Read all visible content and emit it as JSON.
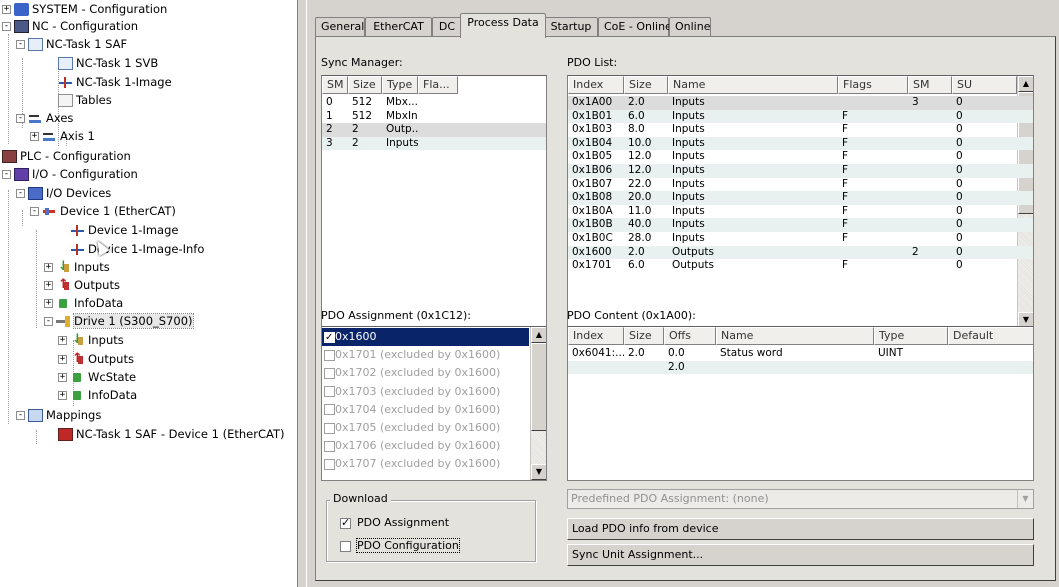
{
  "tree": {
    "nodes": [
      {
        "label": "SYSTEM - Configuration",
        "icon": "system-config-icon",
        "expander": "+"
      },
      {
        "label": "NC - Configuration",
        "icon": "nc-config-icon",
        "expander": "-"
      },
      {
        "label": "NC-Task 1 SAF",
        "icon": "task-icon",
        "expander": "-"
      },
      {
        "label": "NC-Task 1 SVB",
        "icon": "task-icon",
        "expander": ""
      },
      {
        "label": "NC-Task 1-Image",
        "icon": "image-icon",
        "expander": ""
      },
      {
        "label": "Tables",
        "icon": "tables-icon",
        "expander": ""
      },
      {
        "label": "Axes",
        "icon": "axes-icon",
        "expander": "-"
      },
      {
        "label": "Axis 1",
        "icon": "axis-icon",
        "expander": "+"
      },
      {
        "label": "PLC - Configuration",
        "icon": "plc-config-icon",
        "expander": ""
      },
      {
        "label": "I/O - Configuration",
        "icon": "io-config-icon",
        "expander": "-"
      },
      {
        "label": "I/O Devices",
        "icon": "io-devices-icon",
        "expander": "-"
      },
      {
        "label": "Device 1 (EtherCAT)",
        "icon": "ethercat-device-icon",
        "expander": "-"
      },
      {
        "label": "Device 1-Image",
        "icon": "image-icon",
        "expander": ""
      },
      {
        "label": "Device 1-Image-Info",
        "icon": "image-icon",
        "expander": ""
      },
      {
        "label": "Inputs",
        "icon": "inputs-icon",
        "expander": "+"
      },
      {
        "label": "Outputs",
        "icon": "outputs-icon",
        "expander": "+"
      },
      {
        "label": "InfoData",
        "icon": "infodata-icon",
        "expander": "+"
      },
      {
        "label": "Drive 1 (S300_S700)",
        "icon": "drive-icon",
        "expander": "-"
      },
      {
        "label": "Inputs",
        "icon": "inputs-icon",
        "expander": "+"
      },
      {
        "label": "Outputs",
        "icon": "outputs-icon",
        "expander": "+"
      },
      {
        "label": "WcState",
        "icon": "wcstate-icon",
        "expander": "+"
      },
      {
        "label": "InfoData",
        "icon": "infodata-icon",
        "expander": "+"
      },
      {
        "label": "Mappings",
        "icon": "mappings-icon",
        "expander": "-"
      },
      {
        "label": "NC-Task 1 SAF - Device 1 (EtherCAT)",
        "icon": "mapping-link-icon",
        "expander": ""
      }
    ]
  },
  "tabs": [
    "General",
    "EtherCAT",
    "DC",
    "Process Data",
    "Startup",
    "CoE - Online",
    "Online"
  ],
  "active_tab": "Process Data",
  "sync_manager": {
    "caption": "Sync Manager:",
    "headers": [
      "SM",
      "Size",
      "Type",
      "Fla..."
    ],
    "rows": [
      [
        "0",
        "512",
        "Mbx...",
        ""
      ],
      [
        "1",
        "512",
        "MbxIn",
        ""
      ],
      [
        "2",
        "2",
        "Outp...",
        ""
      ],
      [
        "3",
        "2",
        "Inputs",
        ""
      ]
    ]
  },
  "pdo_list": {
    "caption": "PDO List:",
    "headers": [
      "Index",
      "Size",
      "Name",
      "Flags",
      "SM",
      "SU"
    ],
    "rows": [
      [
        "0x1A00",
        "2.0",
        "Inputs",
        "",
        "3",
        "0"
      ],
      [
        "0x1B01",
        "6.0",
        "Inputs",
        "F",
        "",
        "0"
      ],
      [
        "0x1B03",
        "8.0",
        "Inputs",
        "F",
        "",
        "0"
      ],
      [
        "0x1B04",
        "10.0",
        "Inputs",
        "F",
        "",
        "0"
      ],
      [
        "0x1B05",
        "12.0",
        "Inputs",
        "F",
        "",
        "0"
      ],
      [
        "0x1B06",
        "12.0",
        "Inputs",
        "F",
        "",
        "0"
      ],
      [
        "0x1B07",
        "22.0",
        "Inputs",
        "F",
        "",
        "0"
      ],
      [
        "0x1B08",
        "20.0",
        "Inputs",
        "F",
        "",
        "0"
      ],
      [
        "0x1B0A",
        "11.0",
        "Inputs",
        "F",
        "",
        "0"
      ],
      [
        "0x1B0B",
        "40.0",
        "Inputs",
        "F",
        "",
        "0"
      ],
      [
        "0x1B0C",
        "28.0",
        "Inputs",
        "F",
        "",
        "0"
      ],
      [
        "0x1600",
        "2.0",
        "Outputs",
        "",
        "2",
        "0"
      ],
      [
        "0x1701",
        "6.0",
        "Outputs",
        "F",
        "",
        "0"
      ]
    ]
  },
  "pdo_assignment": {
    "caption": "PDO Assignment (0x1C12):",
    "items": [
      {
        "label": "0x1600",
        "checked": true,
        "excluded": false
      },
      {
        "label": "0x1701 (excluded by 0x1600)",
        "checked": false,
        "excluded": true
      },
      {
        "label": "0x1702 (excluded by 0x1600)",
        "checked": false,
        "excluded": true
      },
      {
        "label": "0x1703 (excluded by 0x1600)",
        "checked": false,
        "excluded": true
      },
      {
        "label": "0x1704 (excluded by 0x1600)",
        "checked": false,
        "excluded": true
      },
      {
        "label": "0x1705 (excluded by 0x1600)",
        "checked": false,
        "excluded": true
      },
      {
        "label": "0x1706 (excluded by 0x1600)",
        "checked": false,
        "excluded": true
      },
      {
        "label": "0x1707 (excluded by 0x1600)",
        "checked": false,
        "excluded": true
      }
    ]
  },
  "pdo_content": {
    "caption": "PDO Content (0x1A00):",
    "headers": [
      "Index",
      "Size",
      "Offs",
      "Name",
      "Type",
      "Default"
    ],
    "rows": [
      [
        "0x6041:...",
        "2.0",
        "0.0",
        "Status word",
        "UINT",
        ""
      ],
      [
        "",
        "",
        "2.0",
        "",
        "",
        ""
      ]
    ]
  },
  "download": {
    "label": "Download",
    "pdo_assignment_label": "PDO Assignment",
    "pdo_assignment_checked": true,
    "pdo_configuration_label": "PDO Configuration",
    "pdo_configuration_checked": false
  },
  "predefined": {
    "value": "Predefined PDO Assignment: (none)"
  },
  "buttons": {
    "load_pdo": "Load PDO info from device",
    "sync_unit": "Sync Unit Assignment..."
  }
}
